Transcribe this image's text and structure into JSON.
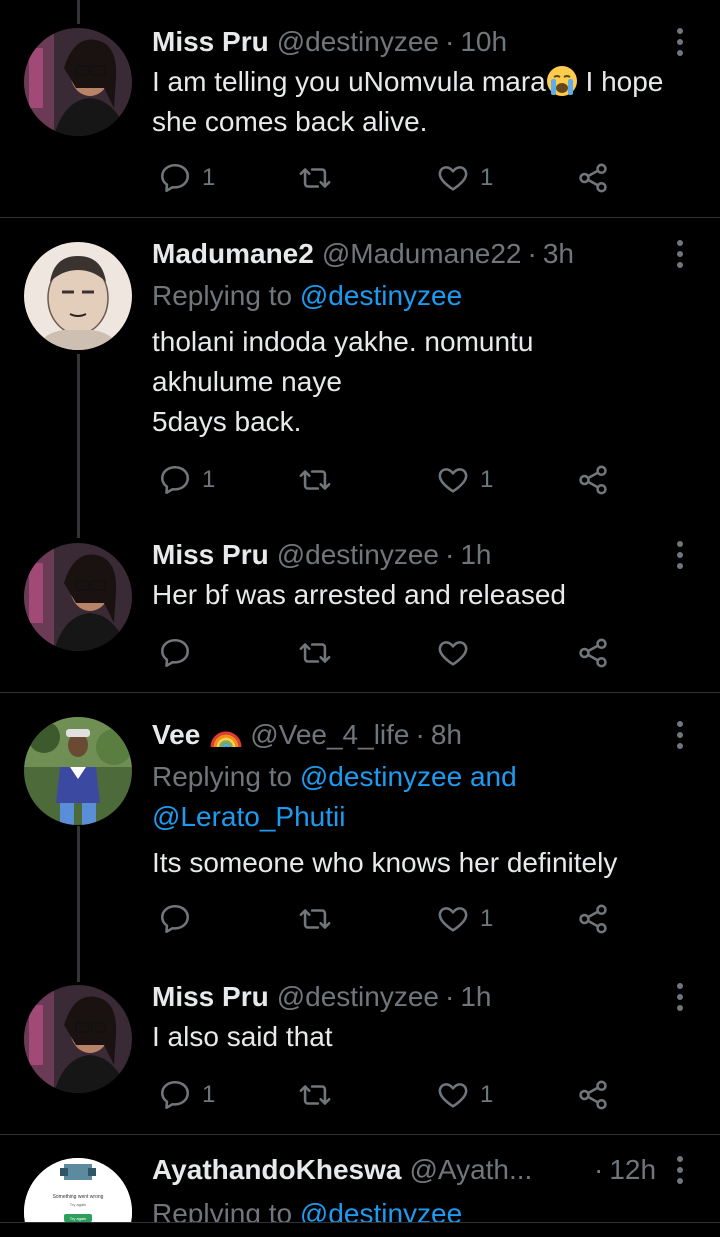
{
  "tweets": [
    {
      "name": "Miss Pru",
      "handle": "@destinyzee",
      "sep": "·",
      "time": "10h",
      "text_before_emoji": "I am telling you uNomvula mara",
      "text_after_emoji": " I hope she comes back alive.",
      "emoji": "crying-face-emoji",
      "reply_count": "1",
      "like_count": "1"
    },
    {
      "name": "Madumane2",
      "handle": "@Madumane22",
      "sep": "·",
      "time": "3h",
      "replying_prefix": "Replying to ",
      "replying_to": "@destinyzee",
      "text": "tholani indoda yakhe. nomuntu\nakhulume naye\n5days back.",
      "reply_count": "1",
      "like_count": "1"
    },
    {
      "name": "Miss Pru",
      "handle": "@destinyzee",
      "sep": "·",
      "time": "1h",
      "text": "Her bf was arrested and released",
      "reply_count": "",
      "like_count": ""
    },
    {
      "name": "Vee",
      "handle": "@Vee_4_life",
      "sep": "·",
      "time": "8h",
      "name_emoji": "rainbow-emoji",
      "replying_prefix": "Replying to ",
      "replying_to": "@destinyzee and",
      "replying_to_2": "@Lerato_Phutii",
      "text": "Its someone who knows her definitely",
      "reply_count": "",
      "like_count": "1"
    },
    {
      "name": "Miss Pru",
      "handle": "@destinyzee",
      "sep": "·",
      "time": "1h",
      "text": "I also said that",
      "reply_count": "1",
      "like_count": "1"
    },
    {
      "name": "AyathandoKheswa",
      "handle": "@Ayath...",
      "sep": "·",
      "time": "12h",
      "replying_prefix": "Replying to ",
      "replying_to": "@destinyzee",
      "avatar_text_1": "Something went wrong",
      "avatar_text_2": "Try again",
      "avatar_button": "Try again"
    }
  ],
  "colors": {
    "background": "#000000",
    "text": "#e7e9ea",
    "muted": "#71767b",
    "link": "#1d9bf0",
    "divider": "#2f3336"
  }
}
